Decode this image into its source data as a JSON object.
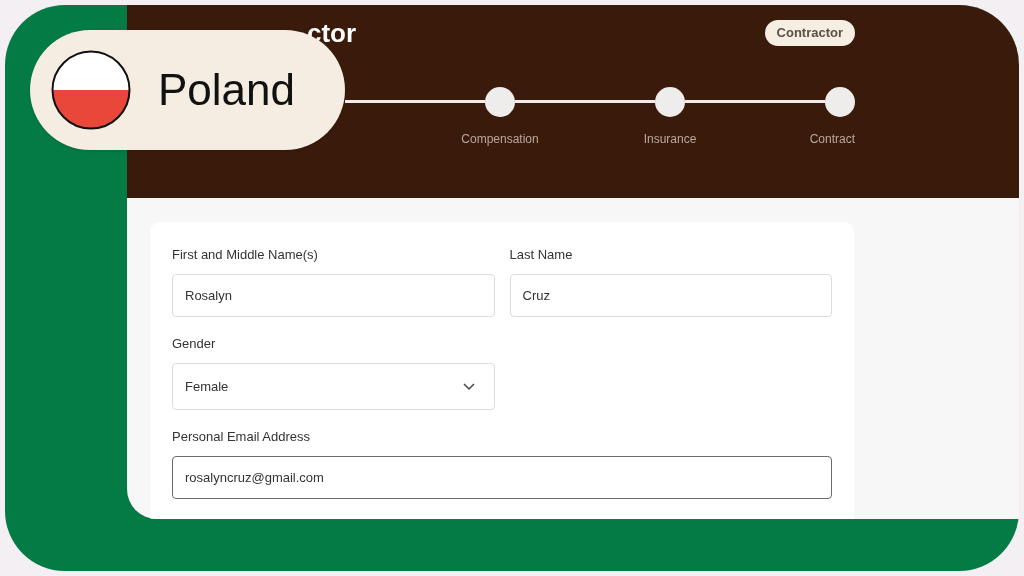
{
  "country_badge": {
    "label": "Poland"
  },
  "header": {
    "title": "ctor",
    "tag": "Contractor",
    "steps": [
      {
        "label": "Compensation"
      },
      {
        "label": "Insurance"
      },
      {
        "label": "Contract"
      }
    ]
  },
  "form": {
    "fields": [
      {
        "kind": "text",
        "label": "First and Middle Name(s)",
        "value": "Rosalyn",
        "focused": false
      },
      {
        "kind": "text",
        "label": "Last Name",
        "value": "Cruz",
        "focused": false
      },
      {
        "kind": "select",
        "label": "Gender",
        "value": "Female",
        "focused": false
      },
      {
        "kind": "email",
        "label": "Personal Email Address",
        "value": "rosalyncruz@gmail.com",
        "focused": true
      }
    ]
  }
}
